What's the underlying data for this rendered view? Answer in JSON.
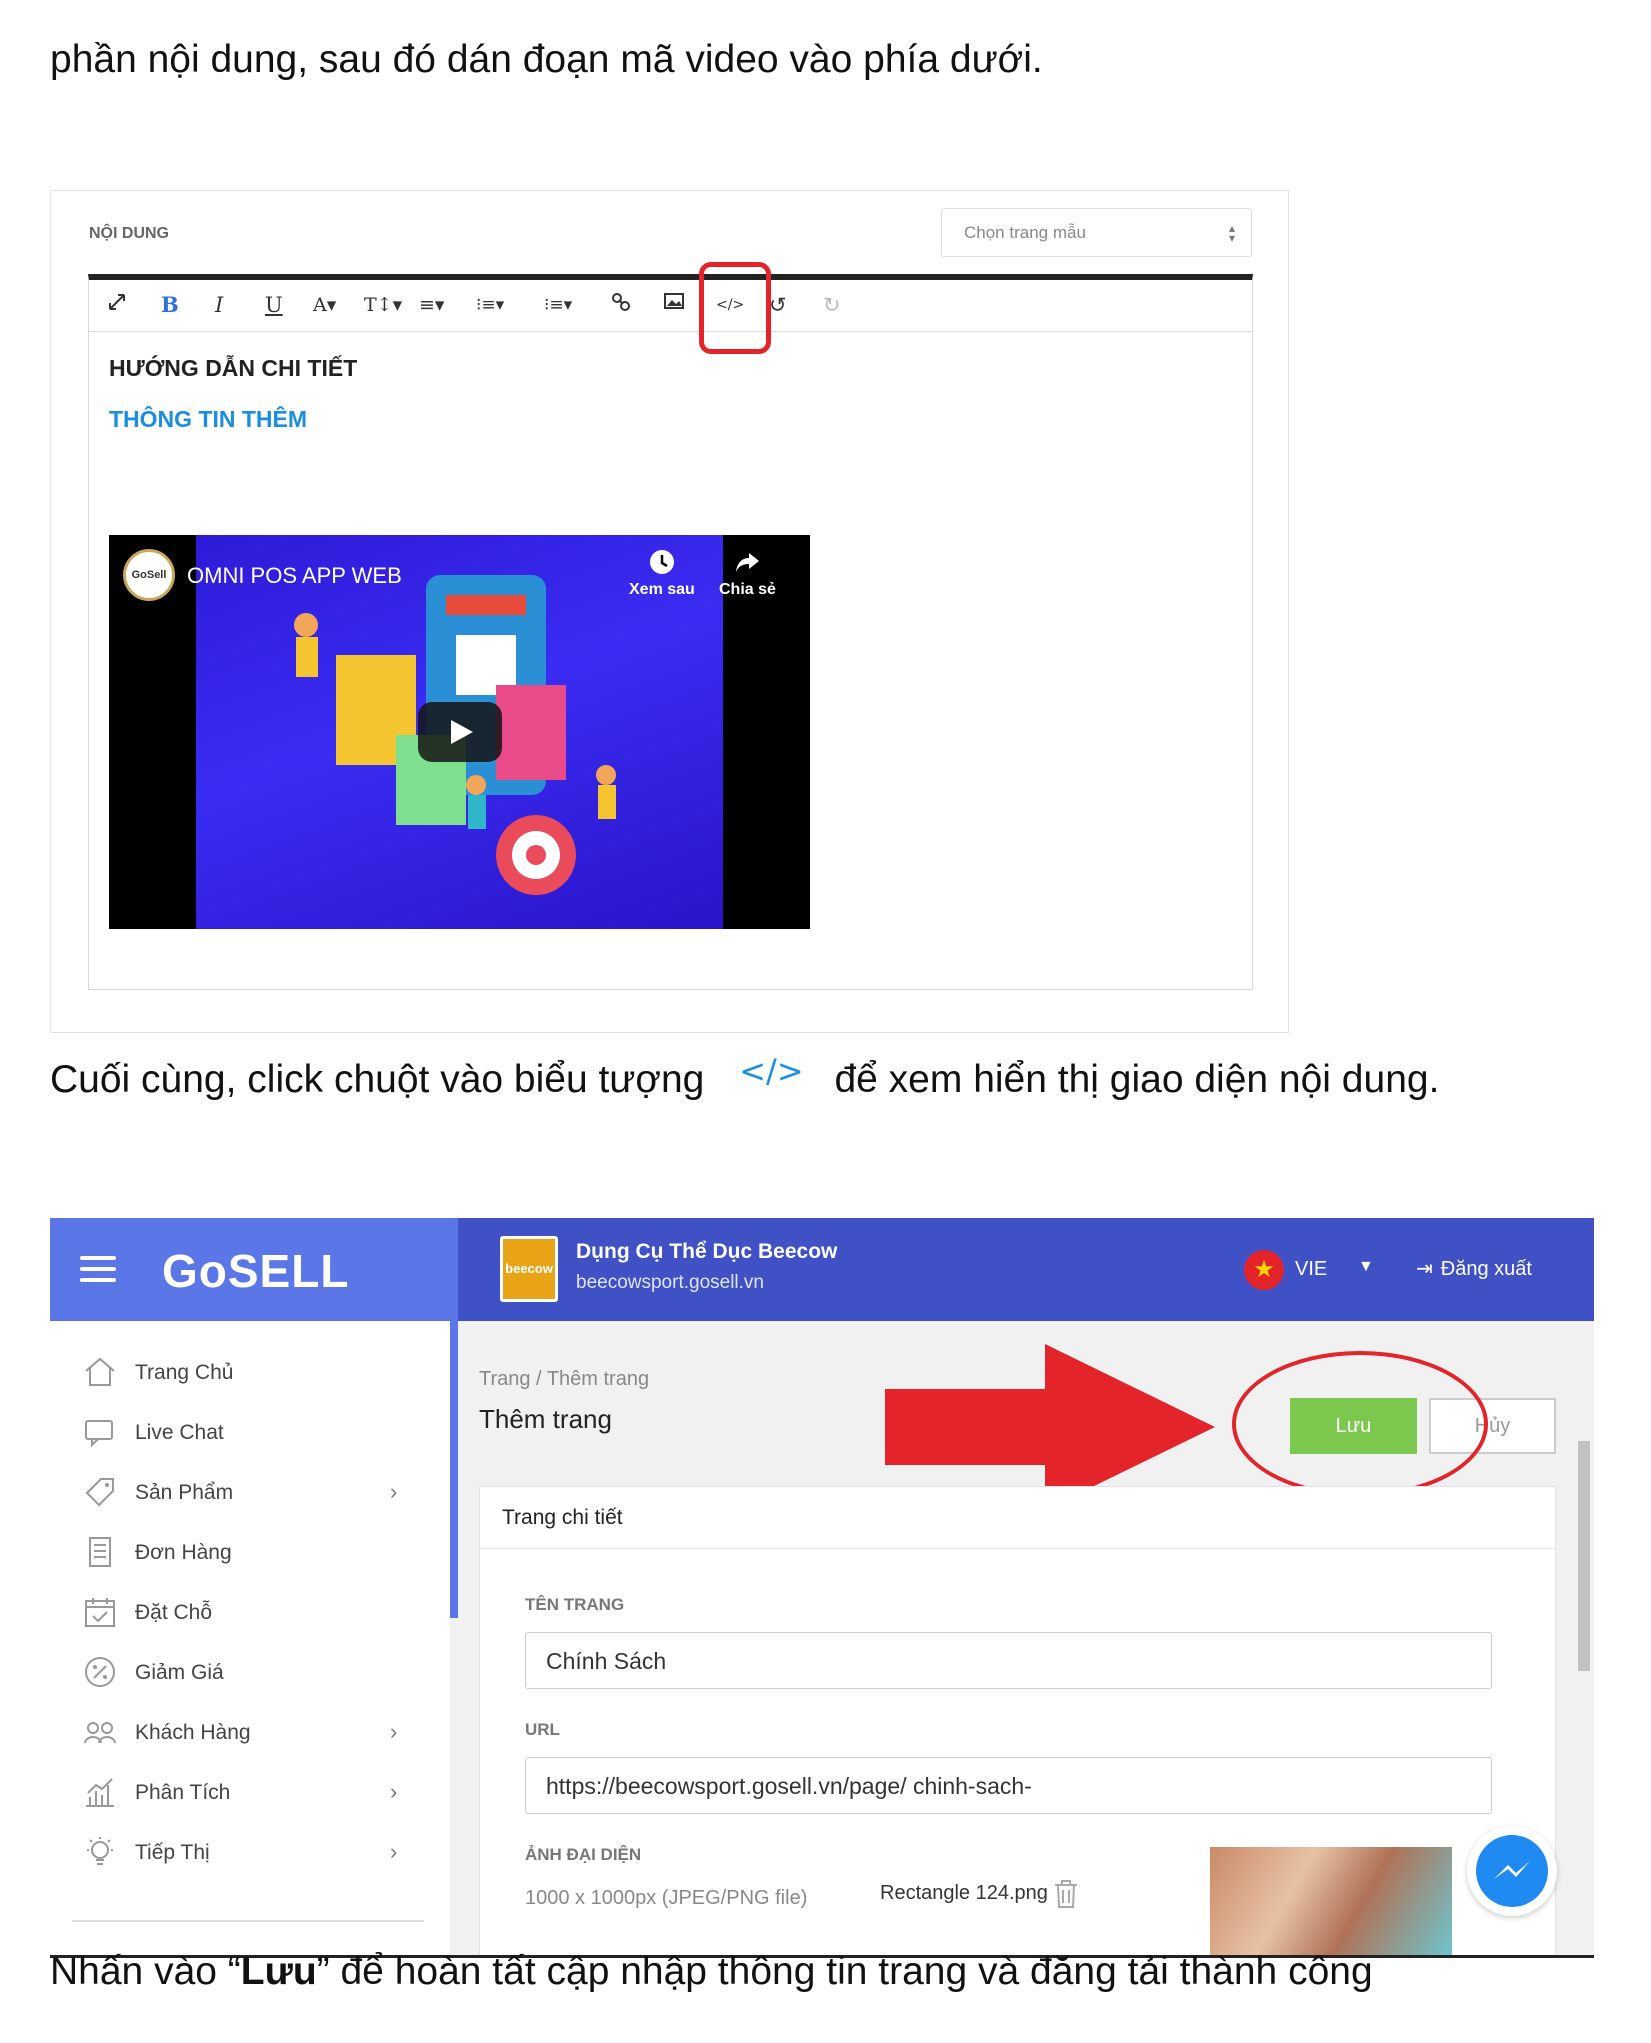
{
  "paragraphs": {
    "intro": "phần nội dung, sau đó dán đoạn mã video vào phía dưới.",
    "final_before": "Cuối cùng, click chuột vào biểu tượng",
    "final_after": "để xem hiển thị giao diện nội dung.",
    "save_before": "Nhấn vào “",
    "save_bold": "Lưu",
    "save_after": "” để hoàn tất cập nhập thông tin trang và đăng tải thành công"
  },
  "editor": {
    "section_label": "NỘI DUNG",
    "template_select": "Chọn trang mẫu",
    "toolbar": {
      "bold": "B",
      "italic": "I",
      "underline": "U",
      "font_color": "A▾",
      "font_size": "T↕▾",
      "align": "≡▾",
      "ordered_list": "⁝≡▾",
      "bullet_list": "⁝≡▾"
    },
    "content": {
      "detail_heading": "HƯỚNG DẪN CHI TIẾT",
      "more_info": "THÔNG TIN THÊM"
    },
    "video": {
      "logo_text": "GoSell",
      "title": "OMNI POS APP WEB",
      "watch_later": "Xem sau",
      "share": "Chia sẻ"
    }
  },
  "admin": {
    "brand": "GoSELL",
    "store": {
      "logo_text": "beecow",
      "name": "Dụng Cụ Thể Dục Beecow",
      "url": "beecowsport.gosell.vn"
    },
    "language": "VIE",
    "logout": "Đăng xuất",
    "sidebar": [
      {
        "label": "Trang Chủ",
        "icon": "home-icon",
        "chevron": ""
      },
      {
        "label": "Live Chat",
        "icon": "chat-icon",
        "chevron": ""
      },
      {
        "label": "Sản Phẩm",
        "icon": "tag-icon",
        "chevron": "›"
      },
      {
        "label": "Đơn Hàng",
        "icon": "order-icon",
        "chevron": ""
      },
      {
        "label": "Đặt Chỗ",
        "icon": "calendar-icon",
        "chevron": ""
      },
      {
        "label": "Giảm Giá",
        "icon": "discount-icon",
        "chevron": ""
      },
      {
        "label": "Khách Hàng",
        "icon": "customers-icon",
        "chevron": "›"
      },
      {
        "label": "Phân Tích",
        "icon": "analytics-icon",
        "chevron": "›"
      },
      {
        "label": "Tiếp Thị",
        "icon": "marketing-icon",
        "chevron": "›"
      }
    ],
    "breadcrumb": "Trang / Thêm trang",
    "page_title": "Thêm trang",
    "save_label": "Lưu",
    "cancel_label": "Hủy",
    "card": {
      "header": "Trang chi tiết",
      "name_label": "TÊN TRANG",
      "name_value": "Chính Sách",
      "url_label": "URL",
      "url_value": "https://beecowsport.gosell.vn/page/  chinh-sach-",
      "image_label": "ẢNH ĐẠI DIỆN",
      "image_spec": "1000 x 1000px (JPEG/PNG file)",
      "image_file": "Rectangle 124.png"
    }
  },
  "colors": {
    "highlight_red": "#e3242b",
    "brand_blue": "#5b76e6",
    "topbar_blue": "#3f51c4",
    "save_green": "#7cc74e",
    "info_blue": "#1a8fe0"
  }
}
